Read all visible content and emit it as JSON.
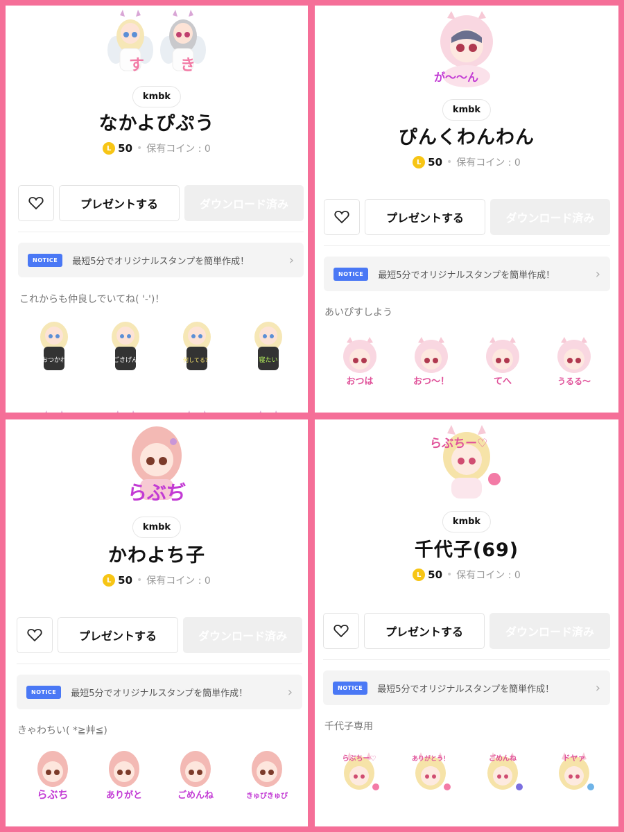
{
  "colors": {
    "frame": "#f56f98",
    "accent_blue": "#4a78f5",
    "coin": "#f7c515",
    "sticker_text": "#c23ad4"
  },
  "panels": [
    {
      "hero_captions": [
        "す",
        "き"
      ],
      "author": "kmbk",
      "title": "なかよぴぷう",
      "coin_letter": "L",
      "price": "50",
      "owned": "保有コイン : 0",
      "buttons": {
        "present": "プレゼントする",
        "download": "ダウンロード済み"
      },
      "notice": {
        "badge": "NOTICE",
        "text": "最短5分でオリジナルスタンプを簡単作成！"
      },
      "description": "これからも仲良しでいてね( '-')！",
      "stickers": [
        "おつかれ",
        "ごきげん",
        "何してる？",
        "寝たい"
      ]
    },
    {
      "hero_captions": [
        "が〜〜ん"
      ],
      "author": "kmbk",
      "title": "ぴんくわんわん",
      "coin_letter": "L",
      "price": "50",
      "owned": "保有コイン : 0",
      "buttons": {
        "present": "プレゼントする",
        "download": "ダウンロード済み"
      },
      "notice": {
        "badge": "NOTICE",
        "text": "最短5分でオリジナルスタンプを簡単作成！"
      },
      "description": "あいぴすしよう",
      "stickers": [
        "おつは",
        "おつ〜！",
        "てへ",
        "うるる〜"
      ]
    },
    {
      "hero_captions": [
        "らぶぢ"
      ],
      "author": "kmbk",
      "title": "かわよち子",
      "coin_letter": "L",
      "price": "50",
      "owned": "保有コイン : 0",
      "buttons": {
        "present": "プレゼントする",
        "download": "ダウンロード済み"
      },
      "notice": {
        "badge": "NOTICE",
        "text": "最短5分でオリジナルスタンプを簡単作成！"
      },
      "description": "きゃわちい( *≧艸≦)",
      "stickers": [
        "らぶち",
        "ありがと",
        "ごめんね",
        "きゅぴきゅぴ"
      ]
    },
    {
      "hero_captions": [
        "らぶちー♡"
      ],
      "author": "kmbk",
      "title": "千代子(69)",
      "coin_letter": "L",
      "price": "50",
      "owned": "保有コイン : 0",
      "buttons": {
        "present": "プレゼントする",
        "download": "ダウンロード済み"
      },
      "notice": {
        "badge": "NOTICE",
        "text": "最短5分でオリジナルスタンプを簡単作成！"
      },
      "description": "千代子専用",
      "stickers": [
        "らぶちー♡",
        "ありがとう！",
        "ごめんね",
        "ドヤァ"
      ]
    }
  ]
}
